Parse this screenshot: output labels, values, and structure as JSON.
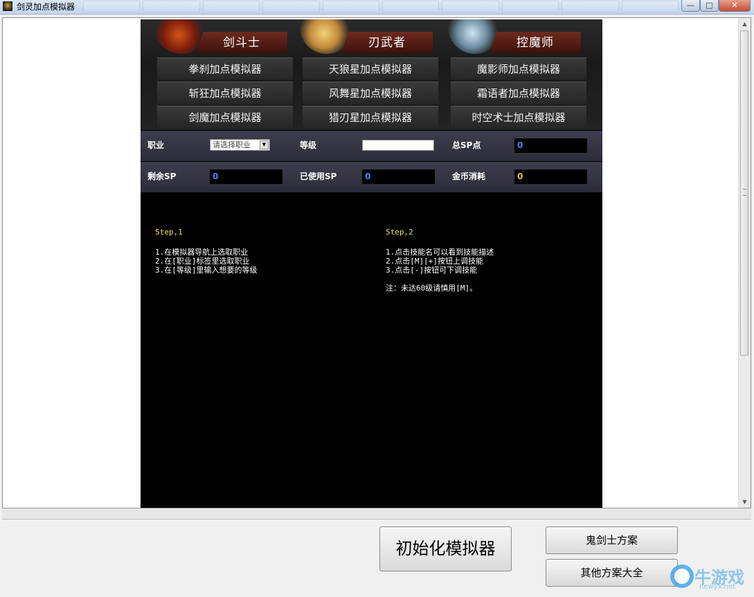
{
  "window": {
    "title": "剑灵加点模拟器",
    "min": "—",
    "max": "□",
    "close": "✕"
  },
  "nav": {
    "columns": [
      {
        "class": "剑斗士",
        "buttons": [
          "拳刹加点模拟器",
          "斩狂加点模拟器",
          "剑魔加点模拟器"
        ]
      },
      {
        "class": "刃武者",
        "buttons": [
          "天狼星加点模拟器",
          "风舞星加点模拟器",
          "猎刃星加点模拟器"
        ]
      },
      {
        "class": "控魔师",
        "buttons": [
          "魔影师加点模拟器",
          "霜语者加点模拟器",
          "时空术士加点模拟器"
        ]
      }
    ]
  },
  "stats": {
    "profession_label": "职业",
    "profession_value": "请选择职业",
    "level_label": "等级",
    "level_value": "",
    "total_sp_label": "总SP点",
    "total_sp": "0",
    "remaining_sp_label": "剩余SP",
    "remaining_sp": "0",
    "used_sp_label": "已使用SP",
    "used_sp": "0",
    "gold_label": "金币消耗",
    "gold": "0"
  },
  "instructions": {
    "step1": {
      "title": "Step,1",
      "lines": [
        "1.在模拟器导航上选取职业",
        "2.在[职业]标签里选取职业",
        "3.在[等级]里输入想要的等级"
      ]
    },
    "step2": {
      "title": "Step,2",
      "lines": [
        "1.点击技能名可以看到技能描述",
        "2.点击[M][+]按钮上调技能",
        "3.点击[-]按钮可下调技能"
      ],
      "note": "注：未达60级请慎用[M]。"
    }
  },
  "bottom": {
    "init_button": "初始化模拟器",
    "ghost_button": "鬼剑士方案",
    "other_button": "其他方案大全"
  },
  "watermark": {
    "text": "牛游戏",
    "sub": "newyx.net"
  },
  "colors": {
    "value_blue": "#3c8cff",
    "gold": "#f2c14a",
    "step_yellow": "#f2e35a",
    "banner_red": "#6e2a1e"
  }
}
